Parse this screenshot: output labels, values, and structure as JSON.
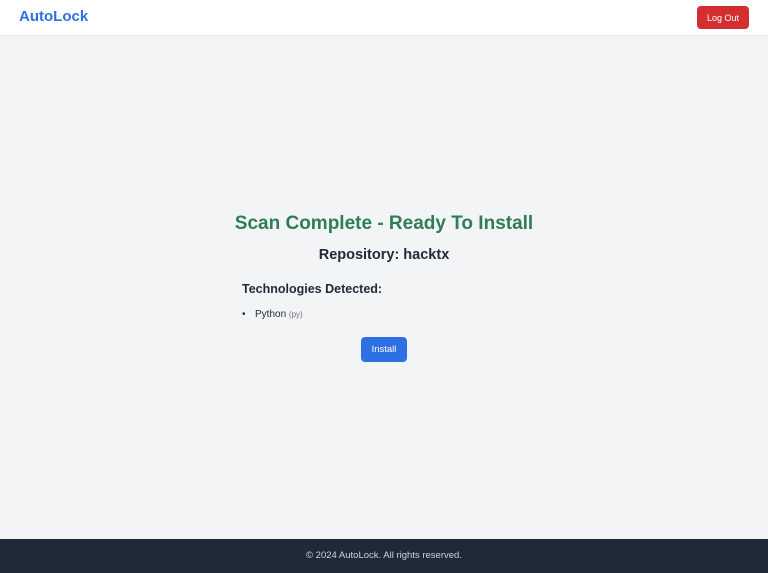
{
  "header": {
    "brand": "AutoLock",
    "logout_label": "Log Out"
  },
  "main": {
    "title": "Scan Complete - Ready To Install",
    "repository_label": "Repository: hacktx",
    "technologies_heading": "Technologies Detected:",
    "technologies": [
      {
        "name": "Python",
        "ext": "(py)"
      }
    ],
    "install_label": "Install"
  },
  "footer": {
    "copyright": "© 2024 AutoLock. All rights reserved."
  },
  "colors": {
    "brand": "#2f6fe4",
    "logout": "#d32f2f",
    "title": "#2e7d57",
    "install": "#2f6fe4",
    "footer_bg": "#1f2937",
    "page_bg": "#f3f4f6"
  }
}
